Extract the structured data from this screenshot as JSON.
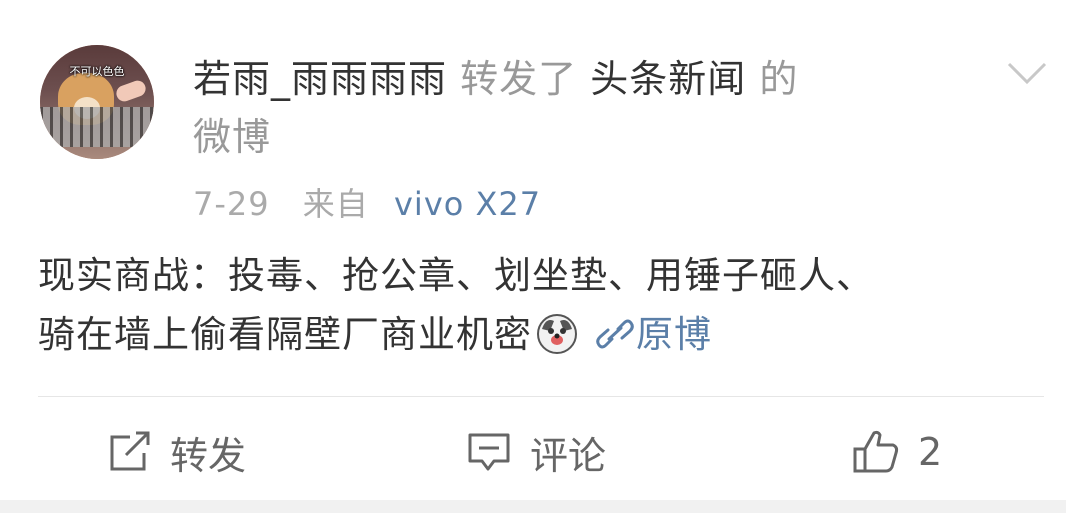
{
  "post": {
    "avatar_caption": "不可以色色",
    "user_name": "若雨_雨雨雨雨",
    "forwarded_label": "转发了",
    "source_name": "头条新闻",
    "of_label": "的",
    "weibo_label": "微博",
    "date": "7-29",
    "from_label": "来自",
    "device": "vivo X27",
    "content_line1": "现实商战：投毒、抢公章、划坐垫、用锤子砸人、",
    "content_line2": "骑在墙上偷看隔壁厂商业机密",
    "origin_link": "原博"
  },
  "actions": {
    "repost_label": "转发",
    "comment_label": "评论",
    "like_count": "2"
  },
  "colors": {
    "link_blue": "#5b7fa8",
    "muted_gray": "#999999",
    "text_dark": "#333333"
  },
  "icons": [
    "chevron-down-icon",
    "link-icon",
    "doge-emoji-icon",
    "share-icon",
    "comment-icon",
    "thumbs-up-icon"
  ]
}
